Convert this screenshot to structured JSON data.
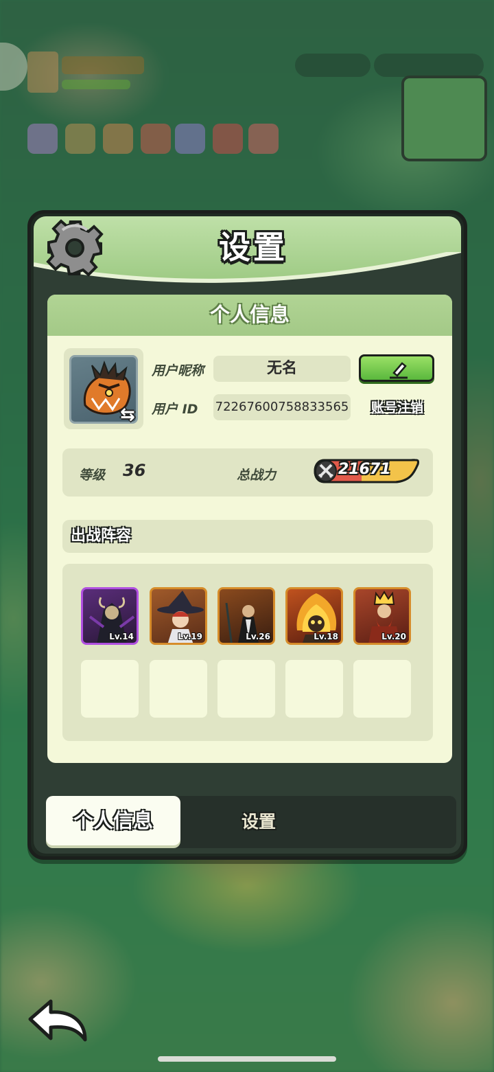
{
  "dialog": {
    "title": "设置",
    "profile_header": "个人信息",
    "nickname_label": "用户昵称",
    "nickname_value": "无名",
    "id_label": "用户  ID",
    "id_value": "72267600758833565",
    "logoff_label": "账号注销",
    "level_label": "等级",
    "level_value": "36",
    "power_label": "总战力",
    "power_value": "21671",
    "lineup_header": "出战阵容",
    "heroes": [
      {
        "level": "Lv.14",
        "rarity": "purple"
      },
      {
        "level": "Lv.19",
        "rarity": "orange"
      },
      {
        "level": "Lv.26",
        "rarity": "orange"
      },
      {
        "level": "Lv.18",
        "rarity": "orange"
      },
      {
        "level": "Lv.20",
        "rarity": "orange"
      }
    ]
  },
  "tabs": {
    "active": "个人信息",
    "other": "设置"
  },
  "colors": {
    "header_green": "#a3c987",
    "panel_bg": "#f4f8d9",
    "edit_green": "#5ab83d",
    "rarity_purple": "#b04fe0",
    "rarity_orange": "#d68c2a"
  },
  "icons": [
    "gear-icon",
    "pencil-icon",
    "swap-icon",
    "swords-icon",
    "back-arrow-icon"
  ]
}
